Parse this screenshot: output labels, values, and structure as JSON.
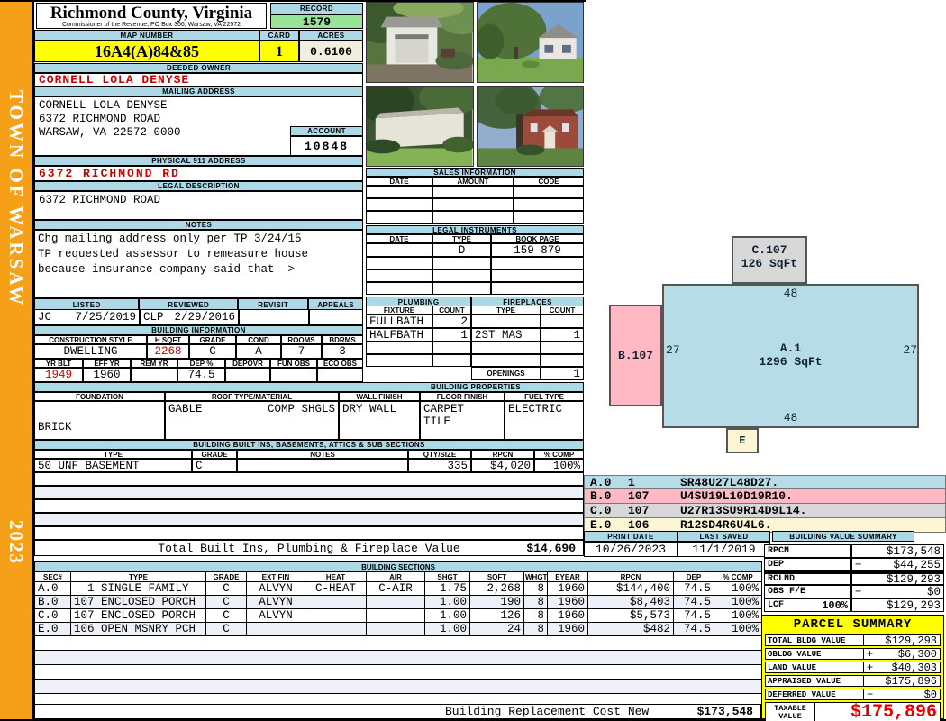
{
  "colors": {
    "bar_blue": "#add8e6",
    "yellow": "#ffff00",
    "record_green": "#9ae29a",
    "beige": "#f0eedd",
    "red_text": "#cc0000",
    "orange": "#f6a01a",
    "taxable_red": "#e80000",
    "sketch_a": "#b6dce8",
    "sketch_b": "#ffb9c5",
    "sketch_c": "#d8d8d8",
    "sketch_e": "#fcf6d4"
  },
  "sidebar": {
    "town": "TOWN OF WARSAW",
    "year": "2023"
  },
  "header": {
    "county": "Richmond County, Virginia",
    "commissioner": "Commissioner of the Revenue, PO Box 366, Warsaw, VA 22572",
    "record_label": "RECORD",
    "record": "1579",
    "map_label": "MAP NUMBER",
    "map_number": "16A4(A)84&85",
    "card_label": "CARD",
    "card": "1",
    "acres_label": "ACRES",
    "acres": "0.6100"
  },
  "owner": {
    "label": "DEEDED OWNER",
    "name": "CORNELL LOLA DENYSE"
  },
  "mailing": {
    "label": "MAILING ADDRESS",
    "line1": "CORNELL LOLA DENYSE",
    "line2": "6372 RICHMOND ROAD",
    "line3": "",
    "line4": "WARSAW, VA 22572-0000",
    "account_label": "ACCOUNT",
    "account": "10848"
  },
  "physical": {
    "label": "PHYSICAL 911 ADDRESS",
    "address": "6372 RICHMOND RD"
  },
  "legal": {
    "label": "LEGAL DESCRIPTION",
    "text": "6372 RICHMOND ROAD"
  },
  "notes": {
    "label": "NOTES",
    "line1": "Chg mailing address only per TP 3/24/15",
    "line2": "TP requested assessor to remeasure house",
    "line3": "because insurance company said that ->"
  },
  "review": {
    "listed_label": "LISTED",
    "reviewed_label": "REVIEWED",
    "revisit_label": "REVISIT",
    "appeals_label": "APPEALS",
    "listed_by": "JC",
    "listed_date": "7/25/2019",
    "reviewed_by": "CLP",
    "reviewed_date": "2/29/2016",
    "revisit": "",
    "appeals": ""
  },
  "building_info": {
    "label": "BUILDING INFORMATION",
    "h1": [
      "CONSTRUCTION STYLE",
      "H SQFT",
      "GRADE",
      "COND",
      "ROOMS",
      "BDRMS"
    ],
    "style": "DWELLING",
    "hsqft": "2268",
    "grade": "C",
    "cond": "A",
    "rooms": "7",
    "bdrms": "3",
    "h2": [
      "YR BLT",
      "EFF YR",
      "REM YR",
      "DEP %",
      "DEPOVR",
      "FUN OBS",
      "ECO OBS"
    ],
    "yr_blt": "1949",
    "eff_yr": "1960",
    "rem_yr": "",
    "dep": "74.5",
    "depovr": "",
    "fun_obs": "",
    "eco_obs": ""
  },
  "props": {
    "label": "BUILDING PROPERTIES",
    "h": [
      "FOUNDATION",
      "ROOF TYPE/MATERIAL",
      "WALL FINISH",
      "FLOOR FINISH",
      "FUEL TYPE"
    ],
    "foundation": "BRICK",
    "roof_type": "GABLE",
    "roof_material": "COMP SHGLS",
    "wall": "DRY WALL",
    "floor1": "CARPET",
    "floor2": "TILE",
    "fuel": "ELECTRIC"
  },
  "built_ins": {
    "label": "BUILDING BUILT INS, BASEMENTS, ATTICS & SUB SECTIONS",
    "h": [
      "TYPE",
      "GRADE",
      "NOTES",
      "QTY/SIZE",
      "RPCN",
      "% COMP"
    ],
    "row": {
      "type": "50 UNF BASEMENT",
      "grade": "C",
      "notes": "",
      "qty": "335",
      "rpcn": "$4,020",
      "comp": "100%"
    },
    "total_label": "Total Built Ins, Plumbing & Fireplace Value",
    "total": "$14,690"
  },
  "sales": {
    "label": "SALES INFORMATION",
    "h": [
      "DATE",
      "AMOUNT",
      "CODE"
    ]
  },
  "instruments": {
    "label": "LEGAL INSTRUMENTS",
    "h": [
      "DATE",
      "TYPE",
      "BOOK PAGE"
    ],
    "row": {
      "date": "",
      "type": "D",
      "book_page": "159 879"
    }
  },
  "plumbing": {
    "label": "PLUMBING",
    "h": [
      "FIXTURE",
      "COUNT"
    ],
    "rows": [
      [
        "FULLBATH",
        "2"
      ],
      [
        "HALFBATH",
        "1"
      ]
    ]
  },
  "fireplaces": {
    "label": "FIREPLACES",
    "h": [
      "TYPE",
      "COUNT"
    ],
    "rows": [
      [
        "",
        ""
      ],
      [
        "2ST MAS",
        "1"
      ]
    ],
    "openings_label": "OPENINGS",
    "openings": "1"
  },
  "photos": {
    "items": [
      "garage-photo",
      "house-lawn-photo",
      "shed-photo",
      "brick-house-photo"
    ]
  },
  "sketch": {
    "a_label": "A.1",
    "a_sqft": "1296 SqFt",
    "b_label": "B.107",
    "c_label": "C.107",
    "c_sqft": "126 SqFt",
    "e_label": "E",
    "dim_top": "48",
    "dim_bottom": "48",
    "dim_left": "27",
    "dim_right": "27",
    "legend": [
      {
        "sec": "A.0",
        "code": "1",
        "path": "SR48U27L48D27."
      },
      {
        "sec": "B.0",
        "code": "107",
        "path": "U4SU19L10D19R10."
      },
      {
        "sec": "C.0",
        "code": "107",
        "path": "U27R13SU9R14D9L14."
      },
      {
        "sec": "E.0",
        "code": "106",
        "path": "R12SD4R6U4L6."
      }
    ]
  },
  "print_info": {
    "print_label": "PRINT DATE",
    "print_date": "10/26/2023",
    "saved_label": "LAST SAVED",
    "last_saved": "11/1/2019"
  },
  "bvs": {
    "label": "BUILDING VALUE SUMMARY",
    "rows": [
      {
        "label": "RPCN",
        "pct": "",
        "sign": "",
        "value": "$173,548"
      },
      {
        "label": "DEP",
        "pct": "",
        "sign": "−",
        "value": "$44,255"
      },
      {
        "label": "RCLND",
        "pct": "",
        "sign": "",
        "value": "$129,293"
      },
      {
        "label": "OBS F/E",
        "pct": "",
        "sign": "−",
        "value": "$0"
      },
      {
        "label": "LCF",
        "pct": "100%",
        "sign": "",
        "value": "$129,293"
      }
    ]
  },
  "sections": {
    "label": "BUILDING SECTIONS",
    "h": [
      "SEC#",
      "TYPE",
      "GRADE",
      "EXT FIN",
      "HEAT",
      "AIR",
      "SHGT",
      "SQFT",
      "WHGT",
      "EYEAR",
      "RPCN",
      "DEP",
      "% COMP"
    ],
    "rows": [
      {
        "sec": "A.0",
        "type": "  1 SINGLE FAMILY",
        "grade": "C",
        "ext": "ALVYN",
        "heat": "C-HEAT",
        "air": "C-AIR",
        "shgt": "1.75",
        "sqft": "2,268",
        "whgt": "8",
        "eyear": "1960",
        "rpcn": "$144,400",
        "dep": "74.5",
        "comp": "100%"
      },
      {
        "sec": "B.0",
        "type": "107 ENCLOSED PORCH",
        "grade": "C",
        "ext": "ALVYN",
        "heat": "",
        "air": "",
        "shgt": "1.00",
        "sqft": "190",
        "whgt": "8",
        "eyear": "1960",
        "rpcn": "$8,403",
        "dep": "74.5",
        "comp": "100%"
      },
      {
        "sec": "C.0",
        "type": "107 ENCLOSED PORCH",
        "grade": "C",
        "ext": "ALVYN",
        "heat": "",
        "air": "",
        "shgt": "1.00",
        "sqft": "126",
        "whgt": "8",
        "eyear": "1960",
        "rpcn": "$5,573",
        "dep": "74.5",
        "comp": "100%"
      },
      {
        "sec": "E.0",
        "type": "106 OPEN MSNRY PCH",
        "grade": "C",
        "ext": "",
        "heat": "",
        "air": "",
        "shgt": "1.00",
        "sqft": "24",
        "whgt": "8",
        "eyear": "1960",
        "rpcn": "$482",
        "dep": "74.5",
        "comp": "100%"
      }
    ]
  },
  "replacement": {
    "label": "Building Replacement Cost New",
    "value": "$173,548"
  },
  "parcel": {
    "label": "PARCEL SUMMARY",
    "rows": [
      {
        "label": "TOTAL BLDG VALUE",
        "sign": "",
        "value": "$129,293"
      },
      {
        "label": "OBLDG VALUE",
        "sign": "+",
        "value": "$6,300"
      },
      {
        "label": "LAND VALUE",
        "sign": "+",
        "value": "$40,303"
      },
      {
        "label": "APPRAISED VALUE",
        "sign": "",
        "value": "$175,896"
      },
      {
        "label": "DEFERRED VALUE",
        "sign": "−",
        "value": "$0"
      }
    ],
    "taxable_label": "TAXABLE VALUE",
    "taxable": "$175,896"
  }
}
